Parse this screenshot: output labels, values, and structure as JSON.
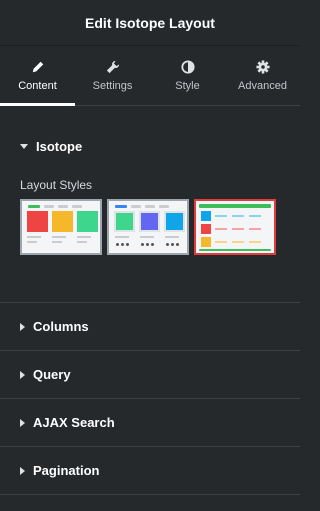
{
  "header": {
    "title": "Edit Isotope Layout"
  },
  "tabs": [
    {
      "label": "Content",
      "icon": "pencil-icon",
      "active": true
    },
    {
      "label": "Settings",
      "icon": "wrench-icon",
      "active": false
    },
    {
      "label": "Style",
      "icon": "contrast-icon",
      "active": false
    },
    {
      "label": "Advanced",
      "icon": "gear-icon",
      "active": false
    }
  ],
  "isotope": {
    "title": "Isotope",
    "layout_styles_label": "Layout Styles",
    "styles": [
      {
        "name": "grid-style",
        "selected": false
      },
      {
        "name": "card-style",
        "selected": false
      },
      {
        "name": "table-style",
        "selected": true
      }
    ]
  },
  "sections": [
    {
      "title": "Columns"
    },
    {
      "title": "Query"
    },
    {
      "title": "AJAX Search"
    },
    {
      "title": "Pagination"
    }
  ],
  "colors": {
    "background": "#26292c",
    "selected_border": "#e23b3b",
    "tab_indicator": "#ffffff"
  }
}
